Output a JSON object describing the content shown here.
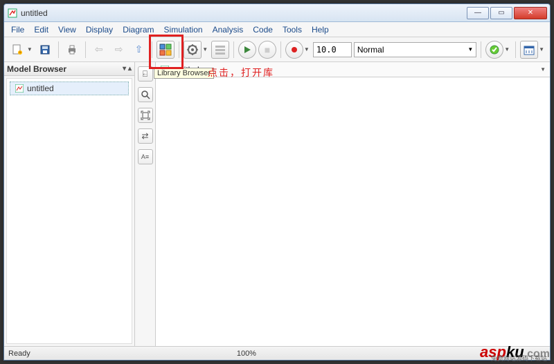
{
  "window": {
    "title": "untitled"
  },
  "menu": [
    "File",
    "Edit",
    "View",
    "Display",
    "Diagram",
    "Simulation",
    "Analysis",
    "Code",
    "Tools",
    "Help"
  ],
  "toolbar": {
    "sim_time": "10.0",
    "sim_mode": "Normal"
  },
  "model_browser": {
    "title": "Model Browser",
    "root": "untitled"
  },
  "breadcrumb": {
    "item": "untitled"
  },
  "status": {
    "left": "Ready",
    "zoom": "100%"
  },
  "tooltip": "Library Browser",
  "annotation": "点击，打开库",
  "watermark": {
    "brand_a": "asp",
    "brand_b": "ku",
    "tld": ".com",
    "sub": "免费网站源码下载站"
  }
}
